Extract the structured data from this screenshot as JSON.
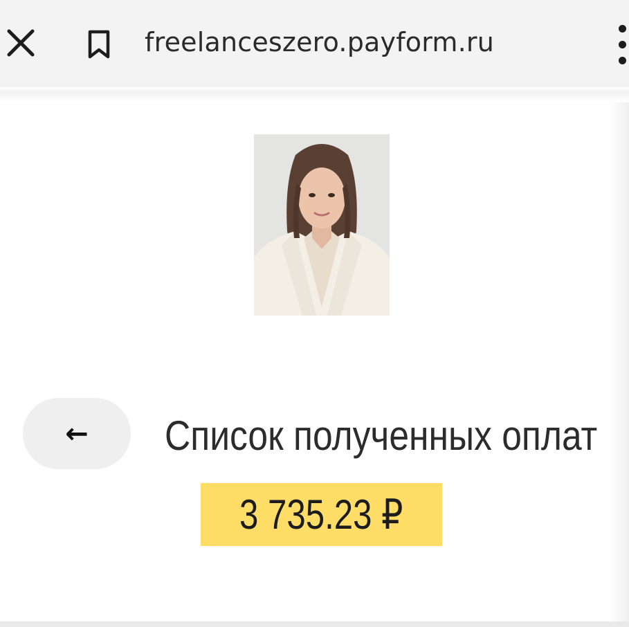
{
  "browser": {
    "url": "freelanceszero.payform.ru",
    "close_icon": "close-icon",
    "bookmark_icon": "bookmark-icon",
    "menu_icon": "more-vertical-icon"
  },
  "page": {
    "back_arrow": "←",
    "heading": "Список полученных оплат",
    "amount": "3 735.23 ₽",
    "amount_highlight_color": "#ffdd66",
    "back_button_color": "#efefef"
  }
}
